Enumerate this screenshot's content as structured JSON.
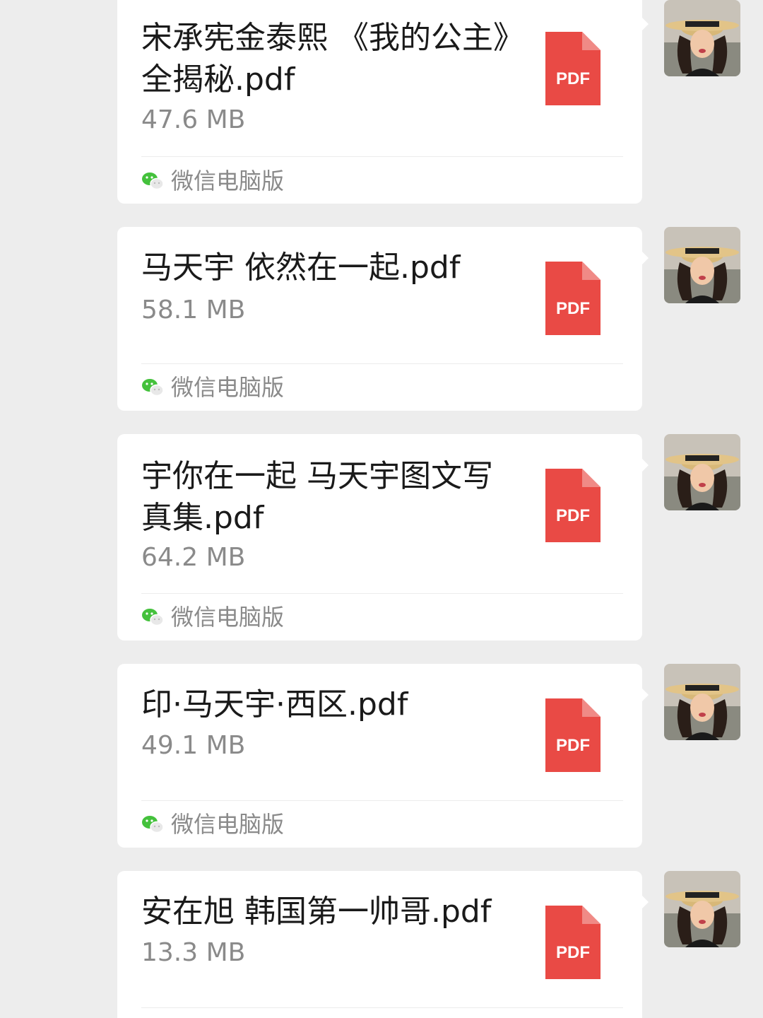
{
  "messages": [
    {
      "file_name": "宋承宪金泰熙 《我的公主》全揭秘.pdf",
      "file_size": "47.6 MB",
      "file_type": "PDF",
      "source": "微信电脑版"
    },
    {
      "file_name": "马天宇 依然在一起.pdf",
      "file_size": "58.1 MB",
      "file_type": "PDF",
      "source": "微信电脑版"
    },
    {
      "file_name": "宇你在一起 马天宇图文写真集.pdf",
      "file_size": "64.2 MB",
      "file_type": "PDF",
      "source": "微信电脑版"
    },
    {
      "file_name": "印·马天宇·西区.pdf",
      "file_size": "49.1 MB",
      "file_type": "PDF",
      "source": "微信电脑版"
    },
    {
      "file_name": "安在旭 韩国第一帅哥.pdf",
      "file_size": "13.3 MB",
      "file_type": "PDF",
      "source": ""
    }
  ],
  "icons": {
    "file": "pdf-file-icon",
    "source": "wechat-icon",
    "avatar": "user-avatar"
  },
  "colors": {
    "background": "#ededed",
    "bubble": "#ffffff",
    "pdf_red": "#e94a45",
    "wechat_green": "#44c13c",
    "secondary_text": "#8a8a8a"
  }
}
